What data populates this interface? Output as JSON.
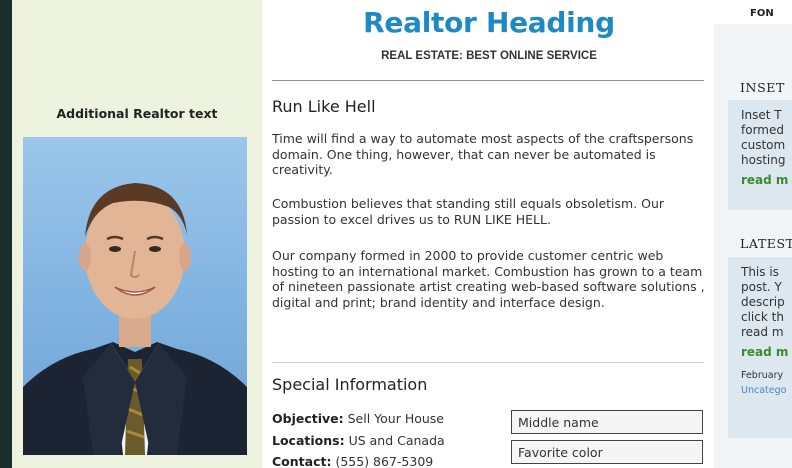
{
  "header": {
    "title": "Realtor Heading",
    "tagline": "REAL ESTATE: BEST ONLINE SERVICE"
  },
  "left_sidebar": {
    "heading": "Additional Realtor text",
    "photo": "realtor-portrait"
  },
  "article": {
    "title": "Run Like Hell",
    "paragraphs": [
      "Time will find a way to automate most aspects of the craftspersons domain. One thing, however, that can never be automated is creativity.",
      "Combustion believes that standing still equals obsoletism. Our passion to excel drives us to RUN LIKE HELL.",
      "Our company formed in 2000 to provide customer centric web hosting to an international market. Combustion has grown to a team of nineteen passionate artist creating web-based software solutions , digital and print; brand identity and interface design."
    ]
  },
  "special": {
    "title": "Special Information",
    "items": [
      {
        "label": "Objective:",
        "value": "Sell Your House"
      },
      {
        "label": "Locations:",
        "value": "US and Canada"
      },
      {
        "label": "Contact:",
        "value": "(555) 867-5309"
      }
    ],
    "fields": [
      {
        "value": "Middle name"
      },
      {
        "value": "Favorite color"
      }
    ]
  },
  "right_sidebar": {
    "top_label": "FON",
    "inset": {
      "heading": "INSET",
      "lines": [
        "Inset T",
        "formed",
        "custom",
        "hosting"
      ],
      "read_more": "read m"
    },
    "latest": {
      "heading": "LATEST",
      "lines": [
        "This is",
        "post. Y",
        "descrip",
        "click th",
        "read m"
      ],
      "read_more": "read m",
      "date": "February",
      "category": "Uncatego"
    }
  },
  "colors": {
    "title_blue": "#1d8ac3",
    "sidebar_bg": "#eef3e0",
    "read_more_green": "#3f8a2e",
    "box_bg": "#dde7ef"
  }
}
